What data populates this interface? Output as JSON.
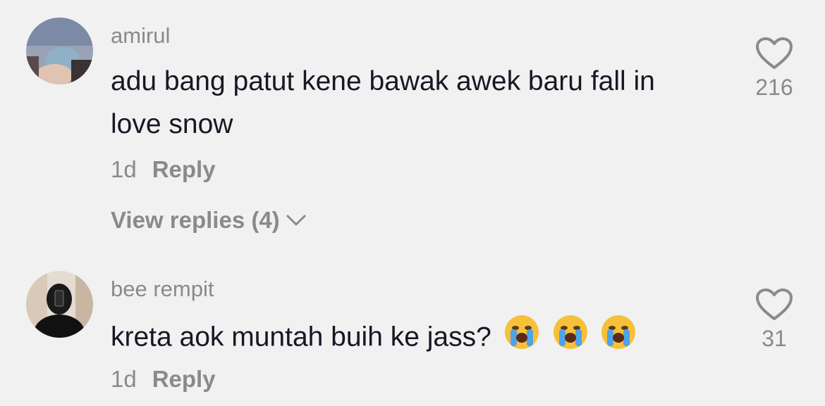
{
  "comments": [
    {
      "username": "amirul",
      "text": "adu bang patut kene bawak awek baru fall in love snow",
      "time": "1d",
      "reply_label": "Reply",
      "view_replies": "View replies (4)",
      "likes": "216",
      "avatar_icon": "profile-photo",
      "emoji": ""
    },
    {
      "username": "bee rempit",
      "text": "kreta aok muntah buih ke jass?",
      "time": "1d",
      "reply_label": "Reply",
      "likes": "31",
      "avatar_icon": "profile-photo",
      "emoji": [
        "loudly-crying-face",
        "loudly-crying-face",
        "loudly-crying-face"
      ]
    }
  ],
  "colors": {
    "background": "#f1f1f2",
    "text": "#161823",
    "muted": "#8a8a8d"
  }
}
